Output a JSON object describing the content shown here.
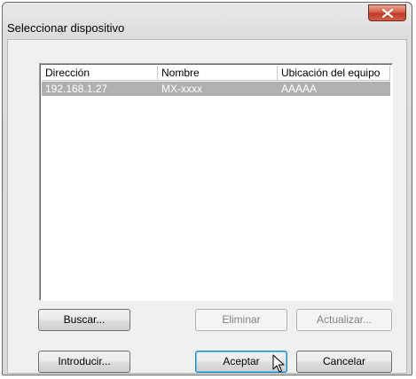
{
  "window": {
    "title": "Seleccionar dispositivo"
  },
  "list": {
    "columns": [
      "Dirección",
      "Nombre",
      "Ubicación del equipo"
    ],
    "rows": [
      {
        "address": "192.168.1.27",
        "name": "MX-xxxx",
        "location": "AAAAA",
        "selected": true
      }
    ]
  },
  "buttons": {
    "search": "Buscar...",
    "delete": "Eliminar",
    "update": "Actualizar...",
    "enter": "Introducir...",
    "ok": "Aceptar",
    "cancel": "Cancelar"
  },
  "colors": {
    "selection": "#b0b0b0",
    "close_button": "#c13b27",
    "dialog_face": "#f0f0f0"
  },
  "icons": [
    "close-icon",
    "mouse-pointer-icon"
  ]
}
